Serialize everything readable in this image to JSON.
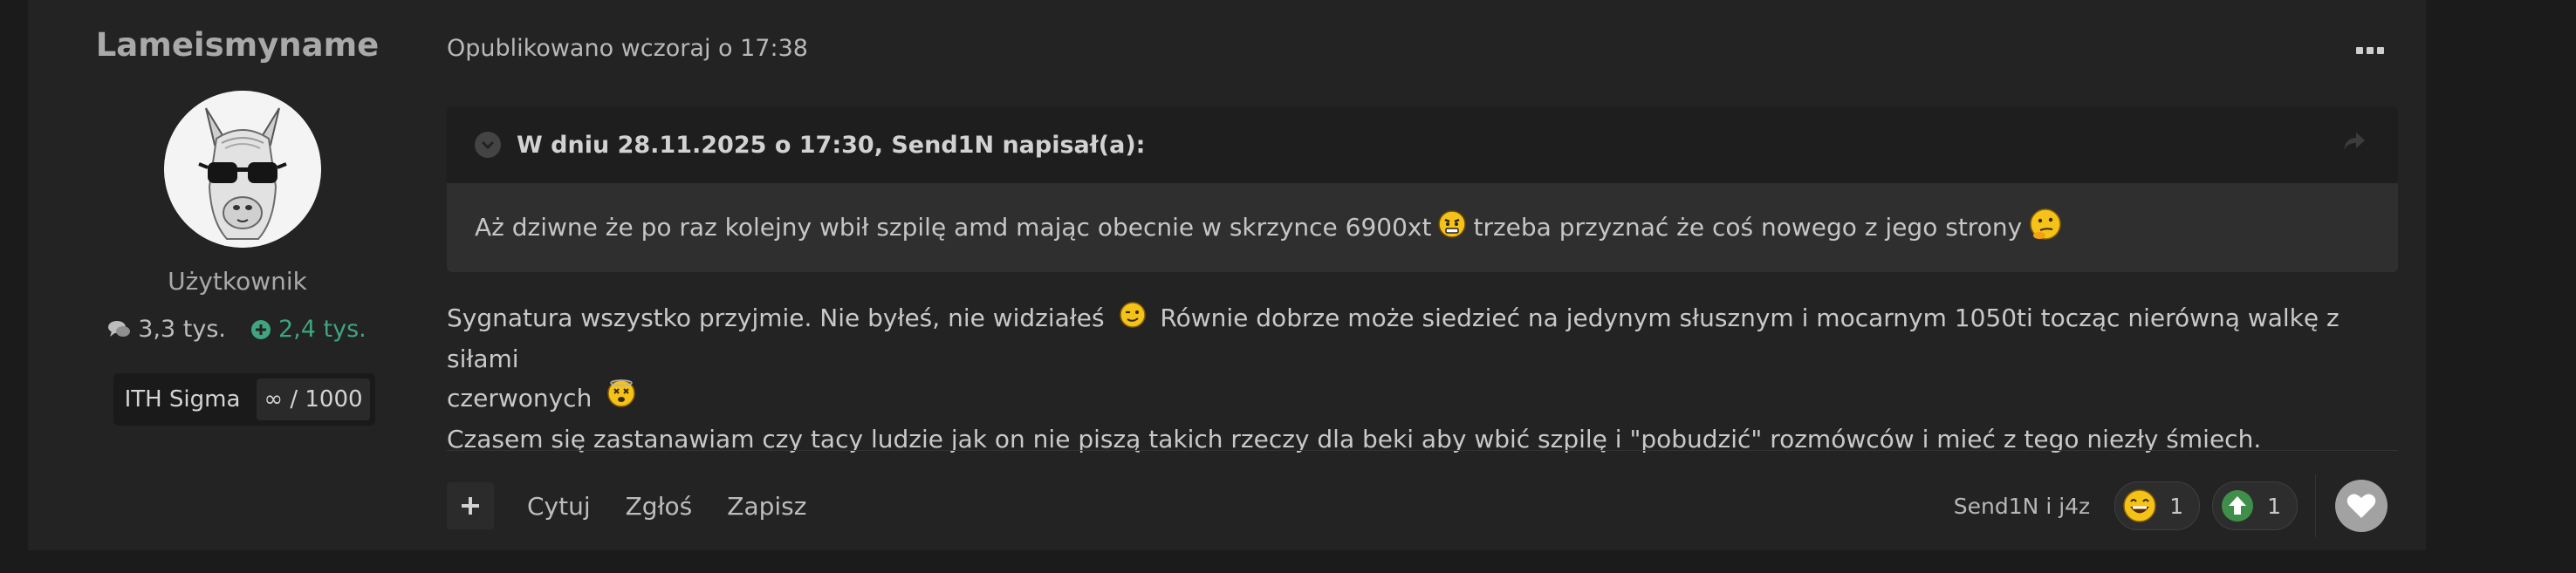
{
  "author": {
    "name": "Lameismyname",
    "rank": "Użytkownik",
    "posts": "3,3 tys.",
    "reputation": "2,4 tys.",
    "badge_name": "ITH Sigma",
    "badge_value": "∞ / 1000",
    "avatar_icon": "llama-with-sunglasses-avatar"
  },
  "post": {
    "meta": "Opublikowano wczoraj o 17:38",
    "quote": {
      "header": "W dniu 28.11.2025 o 17:30, Send1N napisał(a):",
      "text_part1": "Aż dziwne że po raz kolejny wbił szpilę amd mając obecnie w skrzynce 6900xt",
      "text_part2": "trzeba przyznać że coś nowego z jego strony"
    },
    "body": {
      "line1_a": "Sygnatura wszystko przyjmie. Nie byłeś, nie widziałeś",
      "line1_b": "Równie dobrze może siedzieć na jedynym słusznym i mocarnym 1050ti tocząc nierówną walkę z siłami",
      "line2": "czerwonych",
      "line3": "Czasem się zastanawiam czy tacy ludzie jak on nie piszą takich rzeczy dla beki aby wbić szpilę i \"pobudzić\" rozmówców i mieć z tego niezły śmiech."
    }
  },
  "actions": {
    "quote_label": "Cytuj",
    "report_label": "Zgłoś",
    "save_label": "Zapisz"
  },
  "reactions": {
    "reactors": "Send1N i j4z",
    "items": [
      {
        "icon": "laugh-emoji-icon",
        "count": "1"
      },
      {
        "icon": "upvote-icon",
        "count": "1"
      }
    ]
  },
  "colors": {
    "background": "#1b1b1b",
    "card": "#232323",
    "reputation": "#3ea57f"
  }
}
